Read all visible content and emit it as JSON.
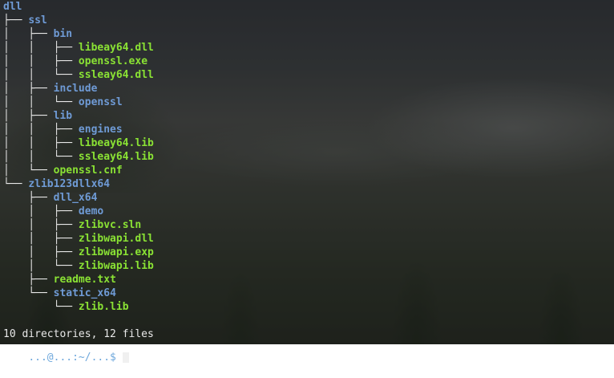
{
  "root": "dll",
  "tree_lines": [
    {
      "prefix": "├── ",
      "name": "ssl",
      "type": "dir"
    },
    {
      "prefix": "│   ├── ",
      "name": "bin",
      "type": "dir"
    },
    {
      "prefix": "│   │   ├── ",
      "name": "libeay64.dll",
      "type": "file"
    },
    {
      "prefix": "│   │   ├── ",
      "name": "openssl.exe",
      "type": "file"
    },
    {
      "prefix": "│   │   └── ",
      "name": "ssleay64.dll",
      "type": "file"
    },
    {
      "prefix": "│   ├── ",
      "name": "include",
      "type": "dir"
    },
    {
      "prefix": "│   │   └── ",
      "name": "openssl",
      "type": "dir"
    },
    {
      "prefix": "│   ├── ",
      "name": "lib",
      "type": "dir"
    },
    {
      "prefix": "│   │   ├── ",
      "name": "engines",
      "type": "dir"
    },
    {
      "prefix": "│   │   ├── ",
      "name": "libeay64.lib",
      "type": "file"
    },
    {
      "prefix": "│   │   └── ",
      "name": "ssleay64.lib",
      "type": "file"
    },
    {
      "prefix": "│   └── ",
      "name": "openssl.cnf",
      "type": "file"
    },
    {
      "prefix": "└── ",
      "name": "zlib123dllx64",
      "type": "dir"
    },
    {
      "prefix": "    ├── ",
      "name": "dll_x64",
      "type": "dir"
    },
    {
      "prefix": "    │   ├── ",
      "name": "demo",
      "type": "dir"
    },
    {
      "prefix": "    │   ├── ",
      "name": "zlibvc.sln",
      "type": "file"
    },
    {
      "prefix": "    │   ├── ",
      "name": "zlibwapi.dll",
      "type": "file"
    },
    {
      "prefix": "    │   ├── ",
      "name": "zlibwapi.exp",
      "type": "file"
    },
    {
      "prefix": "    │   └── ",
      "name": "zlibwapi.lib",
      "type": "file"
    },
    {
      "prefix": "    ├── ",
      "name": "readme.txt",
      "type": "file"
    },
    {
      "prefix": "    └── ",
      "name": "static_x64",
      "type": "dir"
    },
    {
      "prefix": "        └── ",
      "name": "zlib.lib",
      "type": "file"
    }
  ],
  "summary": "10 directories, 12 files",
  "prompt": "...@...:~/...$ ",
  "colors": {
    "directory": "#6f9bd6",
    "file": "#8ae234",
    "text": "#e8e8e8"
  }
}
